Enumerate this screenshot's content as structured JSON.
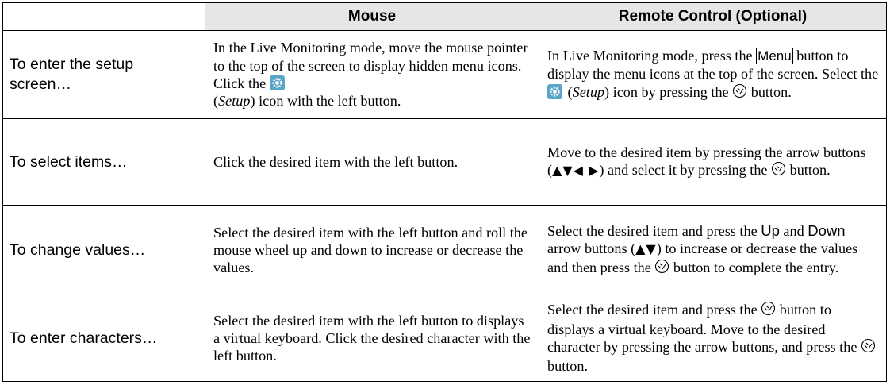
{
  "headers": {
    "blank": "",
    "mouse": "Mouse",
    "remote": "Remote Control (Optional)"
  },
  "rows": [
    {
      "label": "To enter the setup screen…",
      "mouse": {
        "a": "In the Live Monitoring mode, move the mouse pointer to the top of the screen to display hidden menu icons.  Click the ",
        "setup": "Setup",
        "b": " icon with the left button."
      },
      "remote": {
        "a": "In Live Monitoring mode, press the ",
        "menu_key": "Menu",
        "b": " button to display the menu icons at the top of the screen.  Select the ",
        "setup": "Setup",
        "c": " icon by pressing the ",
        "d": " button."
      }
    },
    {
      "label": "To select items…",
      "mouse": {
        "a": "Click the desired item with the left button."
      },
      "remote": {
        "a": "Move to the desired item by pressing the arrow buttons (",
        "arrows": "▲▼◀ ▶",
        "b": ") and select it by pressing the ",
        "c": " button."
      }
    },
    {
      "label": "To change values…",
      "mouse": {
        "a": "Select the desired item with the left button and roll the mouse wheel up and down to increase or decrease the values."
      },
      "remote": {
        "a": "Select the desired item and press the ",
        "up": "Up",
        "and": " and ",
        "down": "Down",
        "b": " arrow buttons (",
        "arrows": "▲▼",
        "c": ") to increase or decrease the values and then press the ",
        "d": " button to complete the entry."
      }
    },
    {
      "label": "To enter characters…",
      "mouse": {
        "a": "Select the desired item with the left button to displays a virtual keyboard.  Click the desired character with the left button."
      },
      "remote": {
        "a": "Select the desired item and press the ",
        "b": " button to displays a virtual keyboard.  Move to the desired character by pressing the arrow buttons, and press the ",
        "c": " button."
      }
    }
  ],
  "icons": {
    "setup": "gear-icon",
    "select_button": "select-button-icon",
    "setup_icon_color": "#5aa6c8",
    "header_bg": "#e6e6e6"
  }
}
